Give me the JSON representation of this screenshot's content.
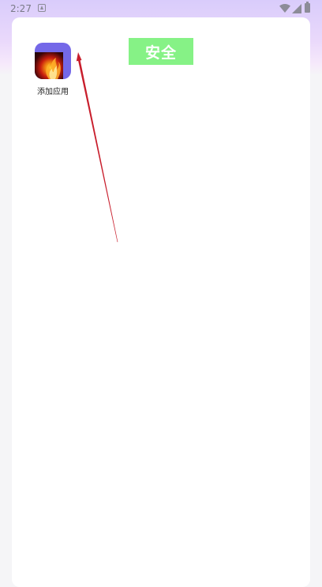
{
  "status_bar": {
    "time": "2:27",
    "notification_icon": "android-notification-icon",
    "wifi_icon": "wifi-icon",
    "signal_icon": "cellular-signal-icon",
    "battery_icon": "battery-icon"
  },
  "security_badge": {
    "label": "安全",
    "color": "#86f286"
  },
  "apps": [
    {
      "label": "添加应用",
      "icon": "phoenix-flame-app-icon",
      "icon_bg": "#7468e8"
    }
  ],
  "annotation": {
    "type": "arrow",
    "color": "#c81e2c"
  },
  "colors": {
    "header_gradient_top": "#d9ccfb",
    "background": "#f5f5f7",
    "card": "#ffffff"
  }
}
